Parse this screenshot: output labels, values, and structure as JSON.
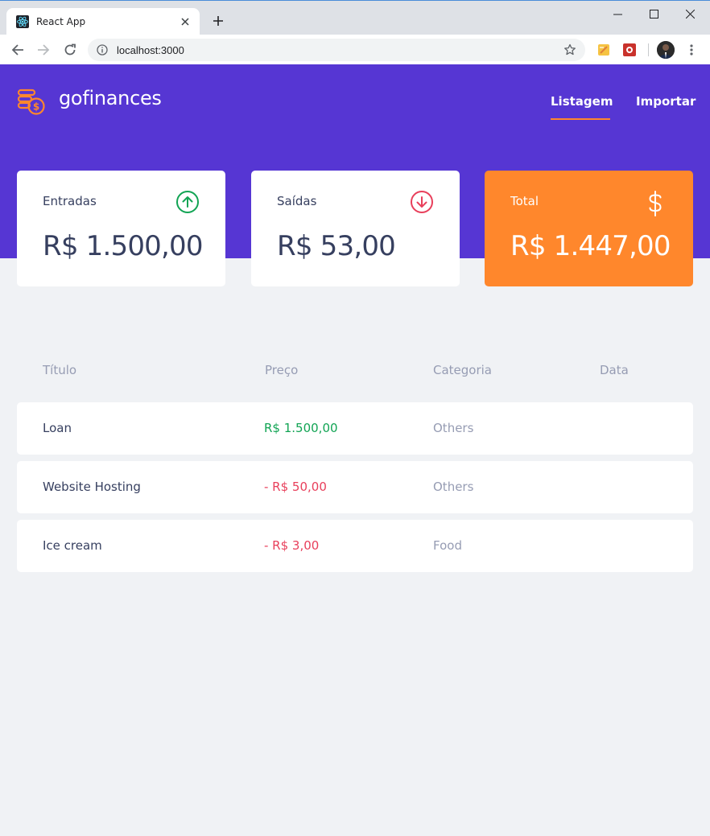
{
  "browser": {
    "tab_title": "React App",
    "url": "localhost:3000"
  },
  "header": {
    "brand": "gofinances",
    "nav": [
      {
        "label": "Listagem",
        "active": true
      },
      {
        "label": "Importar",
        "active": false
      }
    ]
  },
  "colors": {
    "primary": "#5636d3",
    "accent": "#ff872c",
    "income": "#12a454",
    "outcome": "#e83f5b",
    "text": "#363f5f",
    "muted": "#969cb3",
    "background": "#f0f2f5"
  },
  "cards": {
    "income": {
      "title": "Entradas",
      "value": "R$ 1.500,00",
      "icon": "arrow-up-circle-icon"
    },
    "outcome": {
      "title": "Saídas",
      "value": "R$ 53,00",
      "icon": "arrow-down-circle-icon"
    },
    "total": {
      "title": "Total",
      "value": "R$ 1.447,00",
      "icon": "dollar-sign-icon"
    }
  },
  "table": {
    "headers": [
      "Título",
      "Preço",
      "Categoria",
      "Data"
    ],
    "rows": [
      {
        "title": "Loan",
        "price": "R$ 1.500,00",
        "type": "income",
        "category": "Others",
        "date": ""
      },
      {
        "title": "Website Hosting",
        "price": "- R$ 50,00",
        "type": "outcome",
        "category": "Others",
        "date": ""
      },
      {
        "title": "Ice cream",
        "price": "- R$ 3,00",
        "type": "outcome",
        "category": "Food",
        "date": ""
      }
    ]
  }
}
